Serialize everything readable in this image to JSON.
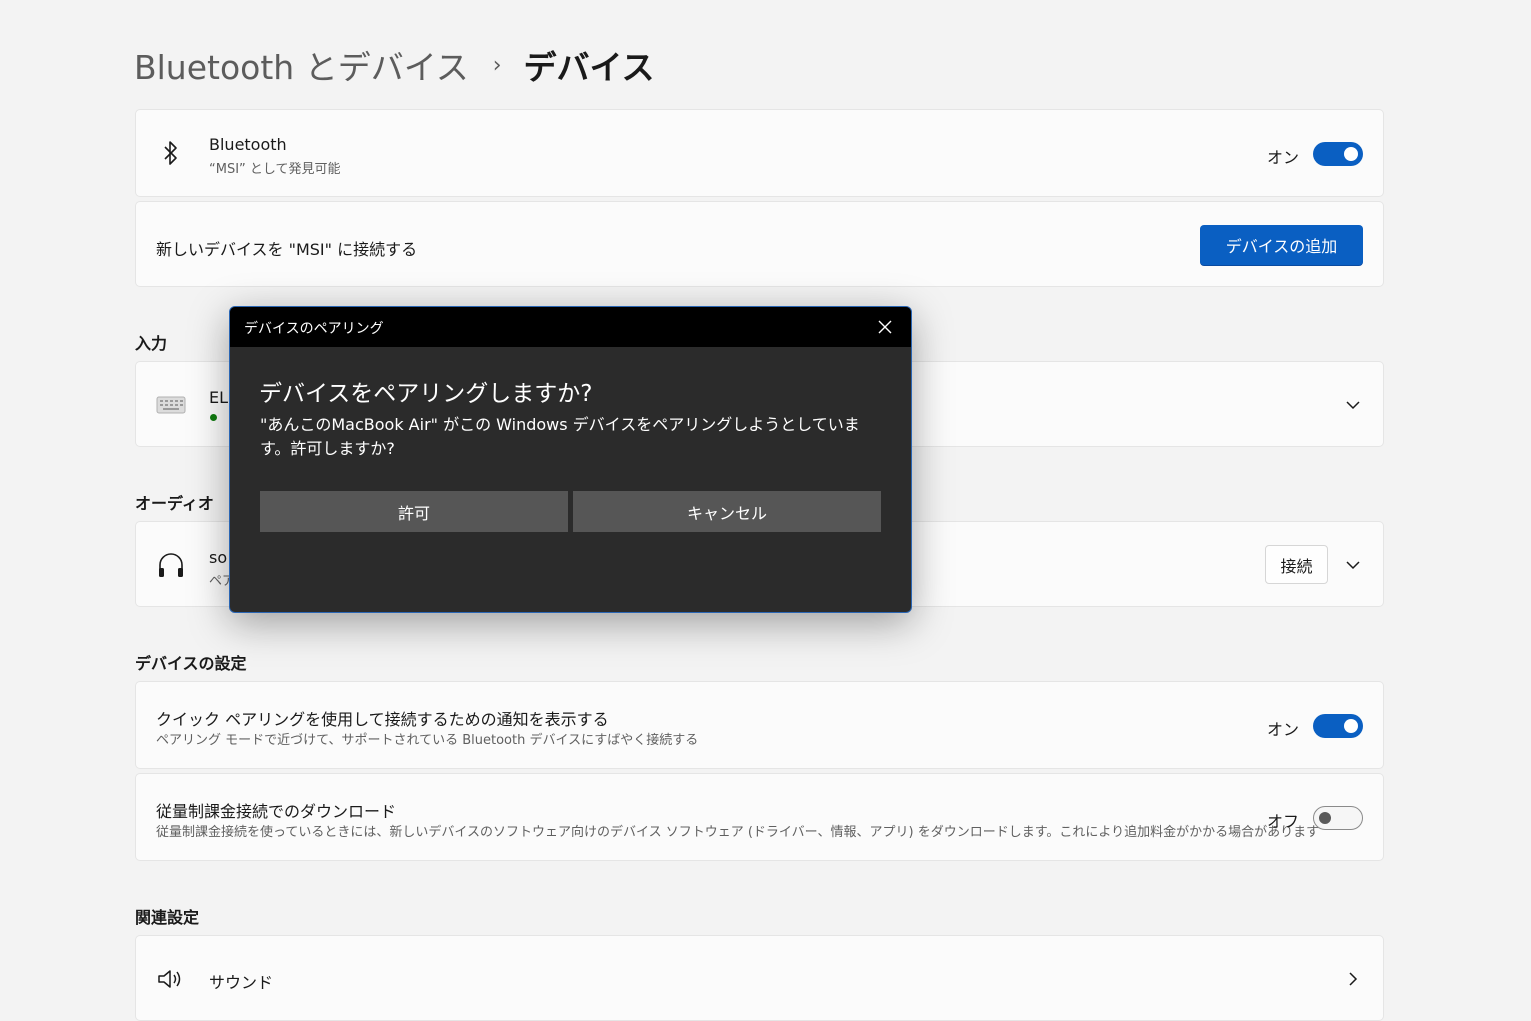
{
  "breadcrumb": {
    "parent": "Bluetooth とデバイス",
    "separator": "›",
    "current": "デバイス"
  },
  "bluetooth": {
    "title": "Bluetooth",
    "subtitle": "“MSI” として発見可能",
    "toggle_label": "オン",
    "toggle_on": true
  },
  "add_device": {
    "text": "新しいデバイスを \"MSI\" に接続する",
    "button": "デバイスの追加"
  },
  "input_section": {
    "title": "入力",
    "device_name": "ELI"
  },
  "audio_section": {
    "title": "オーディオ",
    "device_name": "so",
    "device_status": "ペア",
    "connect_button": "接続"
  },
  "settings_section": {
    "title": "デバイスの設定",
    "swift_pair": {
      "title": "クイック ペアリングを使用して接続するための通知を表示する",
      "subtitle": "ペアリング モードで近づけて、サポートされている Bluetooth デバイスにすばやく接続する",
      "toggle_label": "オン",
      "toggle_on": true
    },
    "metered": {
      "title": "従量制課金接続でのダウンロード",
      "subtitle": "従量制課金接続を使っているときには、新しいデバイスのソフトウェア向けのデバイス ソフトウェア (ドライバー、情報、アプリ) をダウンロードします。これにより追加料金がかかる場合があります",
      "toggle_label": "オフ",
      "toggle_on": false
    }
  },
  "related_section": {
    "title": "関連設定",
    "sound": "サウンド"
  },
  "dialog": {
    "title": "デバイスのペアリング",
    "heading": "デバイスをペアリングしますか?",
    "message": "\"あんこのMacBook Air\" がこの Windows デバイスをペアリングしようとしています。許可しますか?",
    "allow_button": "許可",
    "cancel_button": "キャンセル"
  },
  "colors": {
    "accent": "#0a5fc2",
    "dialog_bg": "#2b2b2b",
    "dialog_titlebar": "#000000",
    "dialog_button": "#565656",
    "status_green": "#107c10"
  }
}
